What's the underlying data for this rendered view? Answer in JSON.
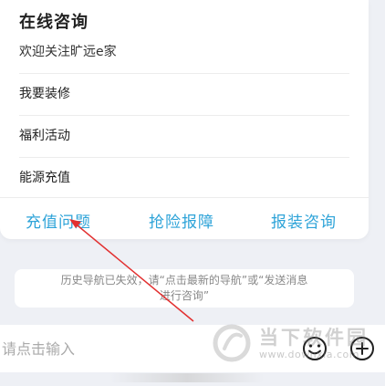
{
  "card": {
    "title": "在线咨询",
    "subtitle": "欢迎关注旷远e家",
    "menu": [
      {
        "label": "我要装修"
      },
      {
        "label": "福利活动"
      },
      {
        "label": "能源充值"
      }
    ],
    "quick_links": [
      {
        "label": "充值问题"
      },
      {
        "label": "抢险报障"
      },
      {
        "label": "报装咨询"
      }
    ]
  },
  "notice": {
    "line1": "历史导航已失效，请“点击最新的导航”或“发送消息",
    "line2": "进行咨询”"
  },
  "input_bar": {
    "placeholder": "请点击输入"
  },
  "icons": {
    "emoji": "smiley-face-icon",
    "plus": "plus-circle-icon"
  },
  "watermark": {
    "name": "当下软件园",
    "url": "www.downxia.com"
  },
  "colors": {
    "accent": "#2da3d8",
    "annotation": "#e23030",
    "background": "#eef0f5"
  }
}
